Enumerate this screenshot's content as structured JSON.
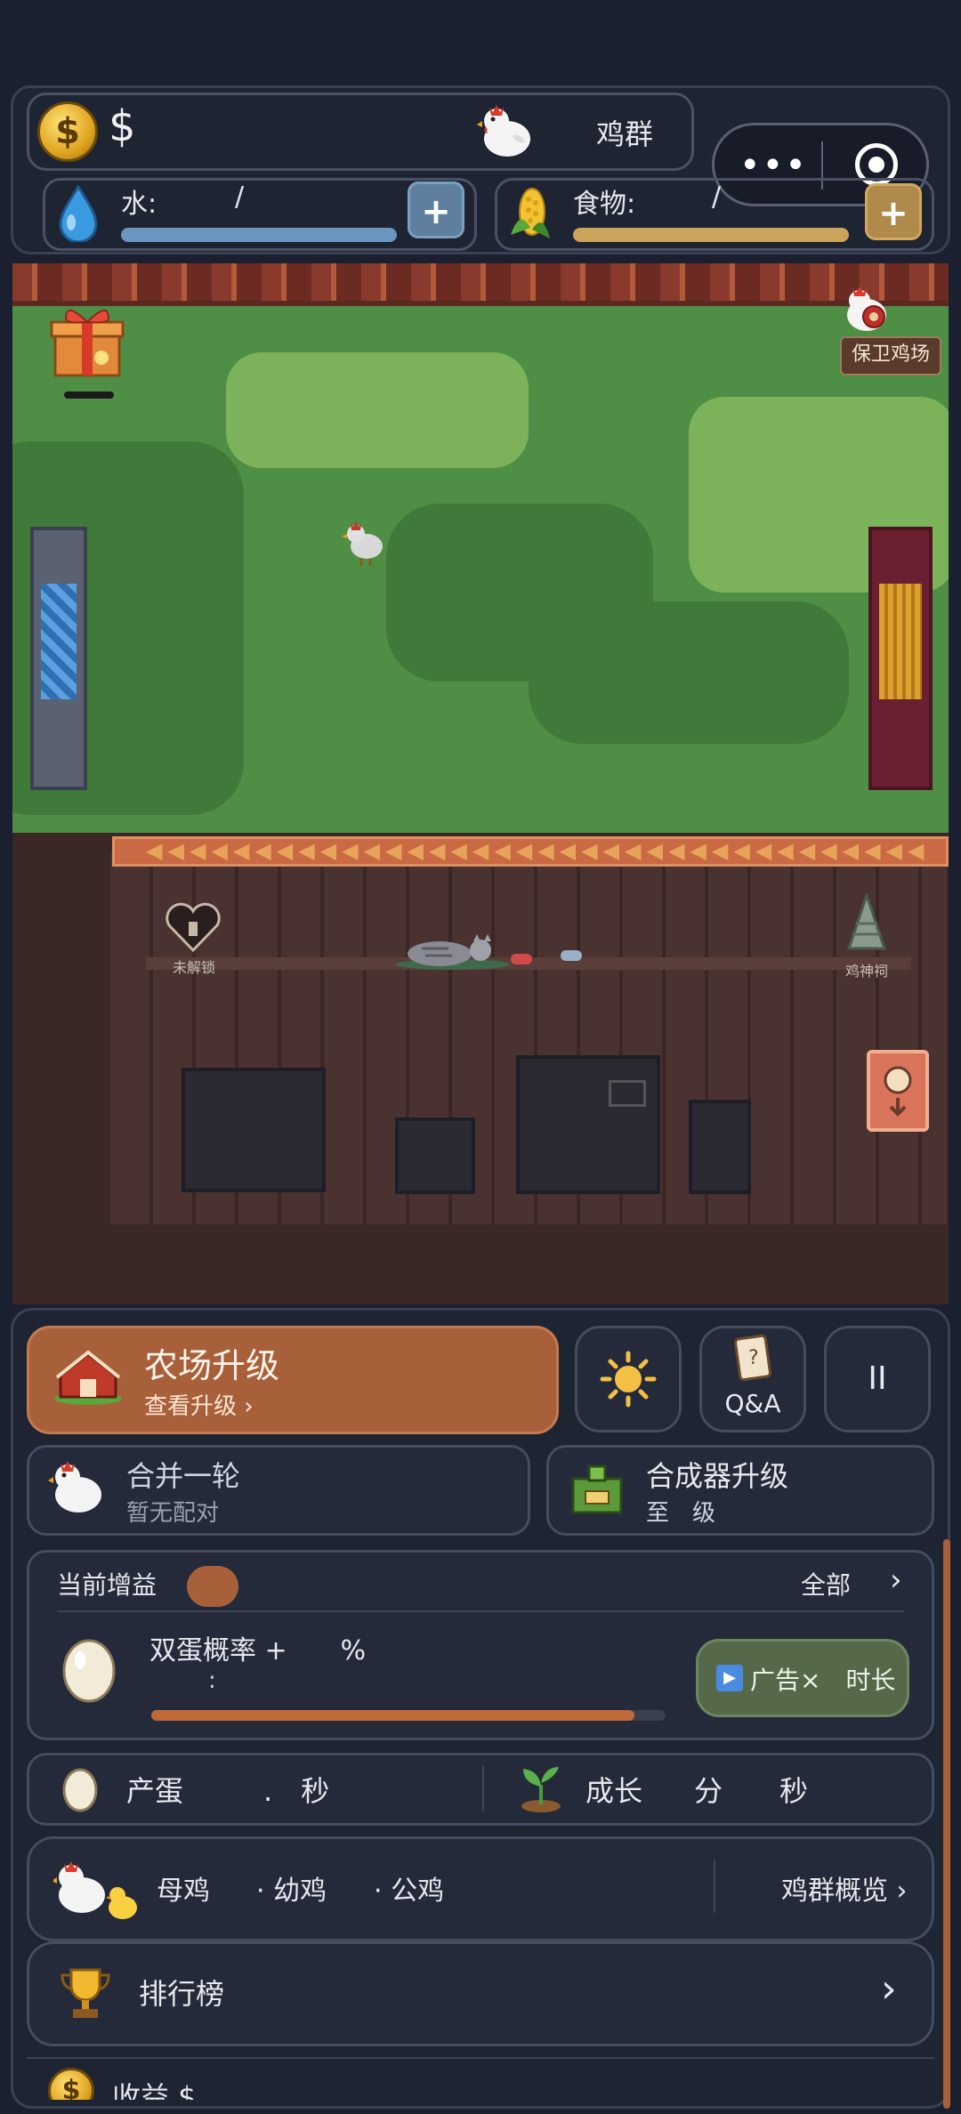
{
  "header": {
    "money": "$",
    "flock_label": "鸡群",
    "water_label": "水:",
    "water_sep": "/",
    "water_fill": 1.0,
    "food_label": "食物:",
    "food_sep": "/",
    "food_fill": 1.0,
    "plus": "+"
  },
  "game": {
    "defend_label": "保卫鸡场",
    "unlock_label": "未解锁",
    "shrine_label": "鸡神祠"
  },
  "panel": {
    "farm_upgrade_title": "农场升级",
    "farm_upgrade_sub": "查看升级 ›",
    "qa_label": "Q&A",
    "pause_label": "II",
    "merge_title": "合并一轮",
    "merge_sub": "暂无配对",
    "synth_title": "合成器升级",
    "synth_sub": "至　级",
    "buff_title": "当前增益",
    "buff_all": "全部",
    "chevron": "›",
    "double_egg": "双蛋概率 +　　%",
    "double_egg_time": ":",
    "buff_progress": 0.94,
    "ad_label": "广告×　时长",
    "egg_label": "产蛋",
    "egg_value": ".　秒",
    "grow_label": "成长",
    "grow_value": "分　　秒",
    "hen_label": "母鸡",
    "chick_label": "· 幼鸡",
    "rooster_label": "· 公鸡",
    "overview_label": "鸡群概览 ›",
    "rank_label": "排行榜",
    "income_label": "收益 $",
    "colors": {
      "accent": "#a8603a",
      "water": "#6a96c0",
      "food": "#c9a45a"
    }
  }
}
